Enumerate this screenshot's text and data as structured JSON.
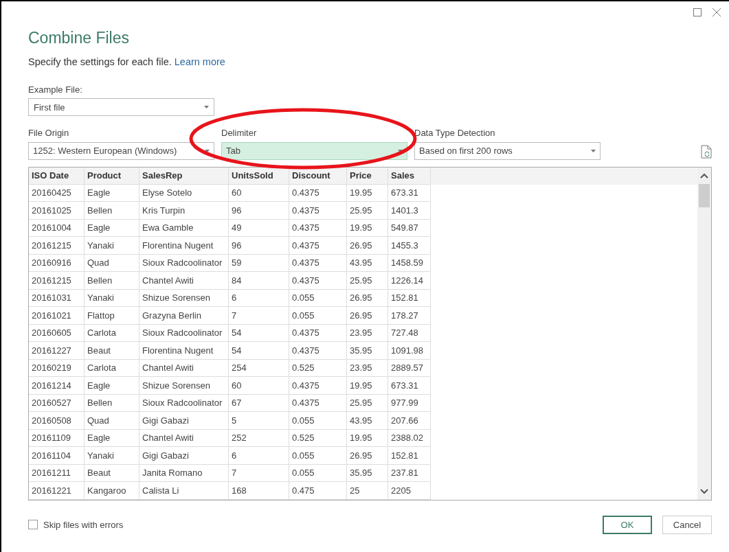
{
  "dialog": {
    "title": "Combine Files",
    "description": "Specify the settings for each file.",
    "learn_more": "Learn more"
  },
  "example_file": {
    "label": "Example File:",
    "value": "First file"
  },
  "settings": [
    {
      "label": "File Origin",
      "value": "1252: Western European (Windows)",
      "highlighted": false
    },
    {
      "label": "Delimiter",
      "value": "Tab",
      "highlighted": true
    },
    {
      "label": "Data Type Detection",
      "value": "Based on first 200 rows",
      "highlighted": false
    }
  ],
  "table": {
    "columns": [
      "ISO Date",
      "Product",
      "SalesRep",
      "UnitsSold",
      "Discount",
      "Price",
      "Sales"
    ],
    "rows": [
      [
        "20160425",
        "Eagle",
        "Elyse Sotelo",
        "60",
        "0.4375",
        "19.95",
        "673.31"
      ],
      [
        "20161025",
        "Bellen",
        "Kris Turpin",
        "96",
        "0.4375",
        "25.95",
        "1401.3"
      ],
      [
        "20161004",
        "Eagle",
        "Ewa Gamble",
        "49",
        "0.4375",
        "19.95",
        "549.87"
      ],
      [
        "20161215",
        "Yanaki",
        "Florentina Nugent",
        "96",
        "0.4375",
        "26.95",
        "1455.3"
      ],
      [
        "20160916",
        "Quad",
        "Sioux Radcoolinator",
        "59",
        "0.4375",
        "43.95",
        "1458.59"
      ],
      [
        "20161215",
        "Bellen",
        "Chantel Awiti",
        "84",
        "0.4375",
        "25.95",
        "1226.14"
      ],
      [
        "20161031",
        "Yanaki",
        "Shizue Sorensen",
        "6",
        "0.055",
        "26.95",
        "152.81"
      ],
      [
        "20161021",
        "Flattop",
        "Grazyna Berlin",
        "7",
        "0.055",
        "26.95",
        "178.27"
      ],
      [
        "20160605",
        "Carlota",
        "Sioux Radcoolinator",
        "54",
        "0.4375",
        "23.95",
        "727.48"
      ],
      [
        "20161227",
        "Beaut",
        "Florentina Nugent",
        "54",
        "0.4375",
        "35.95",
        "1091.98"
      ],
      [
        "20160219",
        "Carlota",
        "Chantel Awiti",
        "254",
        "0.525",
        "23.95",
        "2889.57"
      ],
      [
        "20161214",
        "Eagle",
        "Shizue Sorensen",
        "60",
        "0.4375",
        "19.95",
        "673.31"
      ],
      [
        "20160527",
        "Bellen",
        "Sioux Radcoolinator",
        "67",
        "0.4375",
        "25.95",
        "977.99"
      ],
      [
        "20160508",
        "Quad",
        "Gigi Gabazi",
        "5",
        "0.055",
        "43.95",
        "207.66"
      ],
      [
        "20161109",
        "Eagle",
        "Chantel Awiti",
        "252",
        "0.525",
        "19.95",
        "2388.02"
      ],
      [
        "20161104",
        "Yanaki",
        "Gigi Gabazi",
        "6",
        "0.055",
        "26.95",
        "152.81"
      ],
      [
        "20161211",
        "Beaut",
        "Janita Romano",
        "7",
        "0.055",
        "35.95",
        "237.81"
      ],
      [
        "20161221",
        "Kangaroo",
        "Calista Li",
        "168",
        "0.475",
        "25",
        "2205"
      ]
    ]
  },
  "skip_files": {
    "label": "Skip files with errors",
    "checked": false
  },
  "buttons": [
    {
      "label": "OK",
      "kind": "primary"
    },
    {
      "label": "Cancel",
      "kind": "secondary"
    }
  ]
}
